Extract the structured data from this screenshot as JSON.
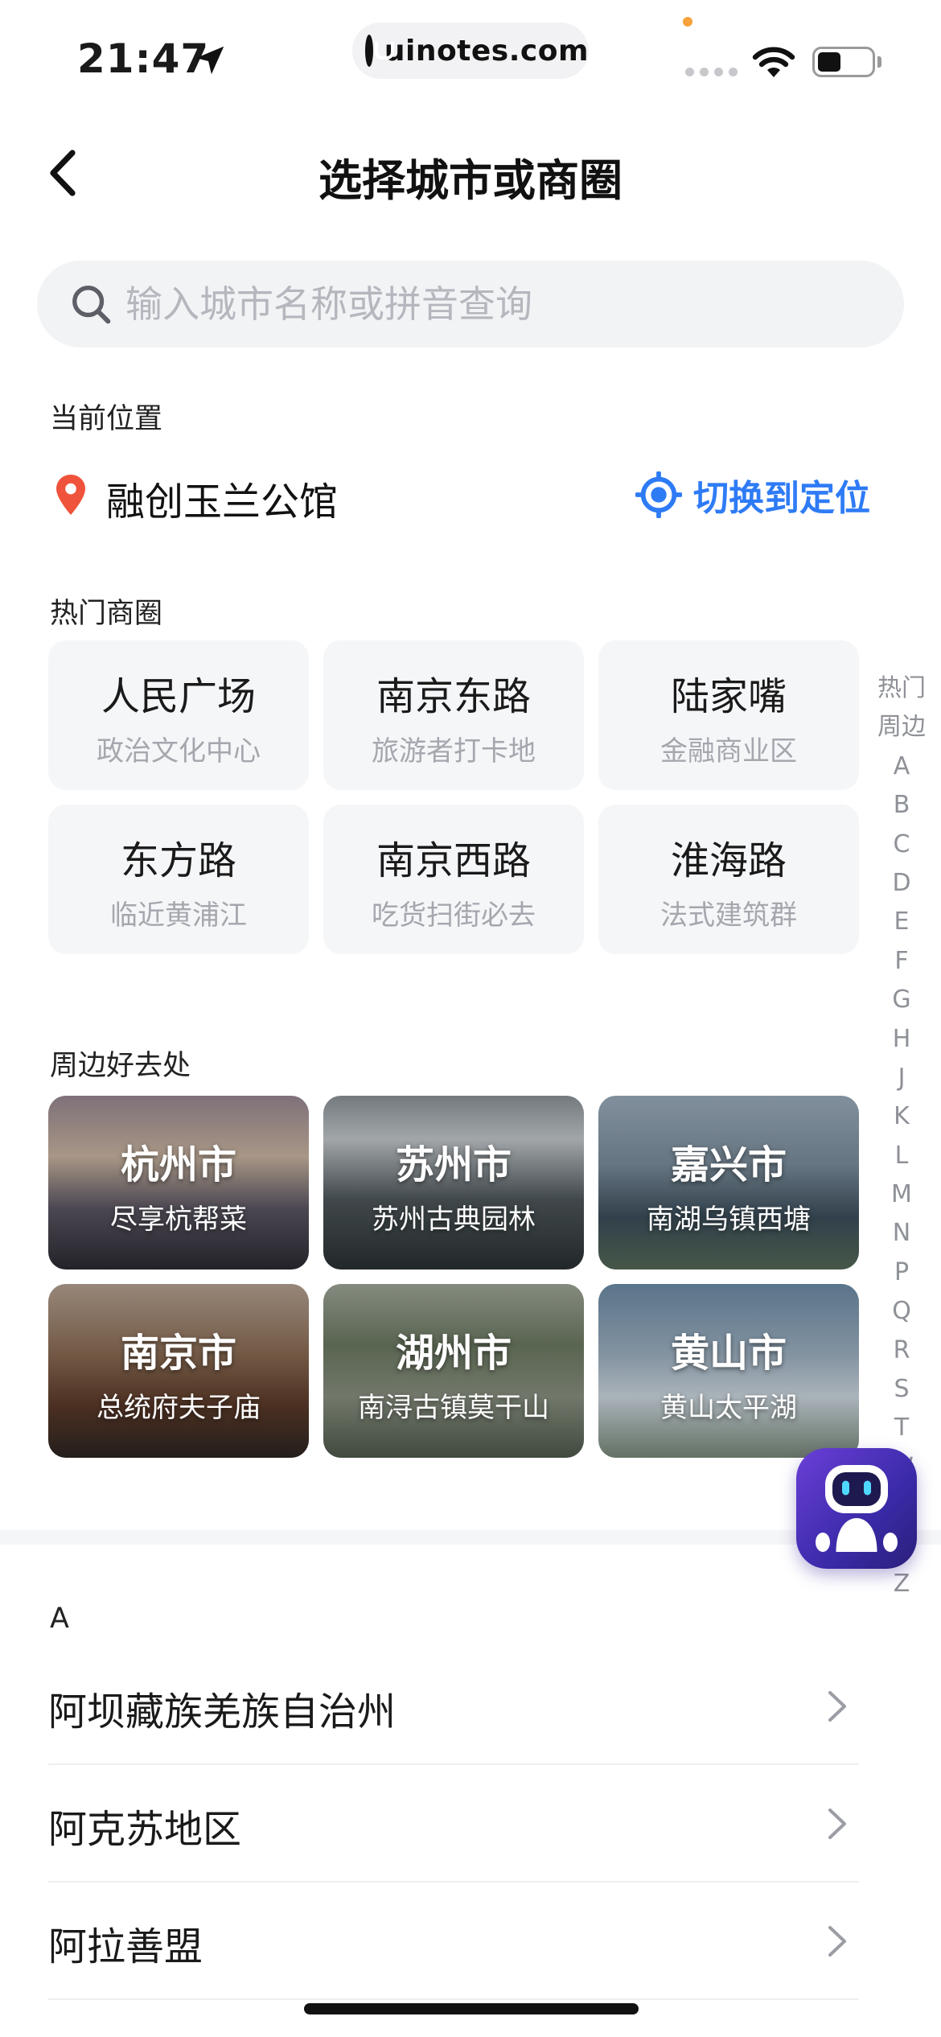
{
  "status_bar": {
    "time": "21:47",
    "url": "uinotes.com"
  },
  "header": {
    "title": "选择城市或商圈"
  },
  "search": {
    "placeholder": "输入城市名称或拼音查询"
  },
  "current_location": {
    "label": "当前位置",
    "name": "融创玉兰公馆",
    "switch_label": "切换到定位",
    "accent_color": "#2e7bf6",
    "pin_color": "#f0533b"
  },
  "hot_areas": {
    "label": "热门商圈",
    "items": [
      {
        "title": "人民广场",
        "subtitle": "政治文化中心"
      },
      {
        "title": "南京东路",
        "subtitle": "旅游者打卡地"
      },
      {
        "title": "陆家嘴",
        "subtitle": "金融商业区"
      },
      {
        "title": "东方路",
        "subtitle": "临近黄浦江"
      },
      {
        "title": "南京西路",
        "subtitle": "吃货扫街必去"
      },
      {
        "title": "淮海路",
        "subtitle": "法式建筑群"
      }
    ]
  },
  "nearby": {
    "label": "周边好去处",
    "items": [
      {
        "title": "杭州市",
        "subtitle": "尽享杭帮菜"
      },
      {
        "title": "苏州市",
        "subtitle": "苏州古典园林"
      },
      {
        "title": "嘉兴市",
        "subtitle": "南湖乌镇西塘"
      },
      {
        "title": "南京市",
        "subtitle": "总统府夫子庙"
      },
      {
        "title": "湖州市",
        "subtitle": "南浔古镇莫干山"
      },
      {
        "title": "黄山市",
        "subtitle": "黄山太平湖"
      }
    ]
  },
  "index_bar": [
    "热门",
    "周边",
    "A",
    "B",
    "C",
    "D",
    "E",
    "F",
    "G",
    "H",
    "J",
    "K",
    "L",
    "M",
    "N",
    "P",
    "Q",
    "R",
    "S",
    "T",
    "W",
    "X",
    "Y",
    "Z"
  ],
  "city_list": {
    "group": "A",
    "cities": [
      "阿坝藏族羌族自治州",
      "阿克苏地区",
      "阿拉善盟"
    ]
  }
}
